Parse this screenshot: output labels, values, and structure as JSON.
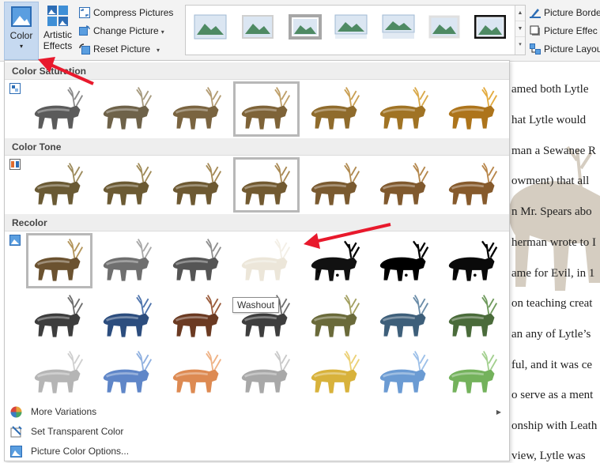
{
  "ribbon": {
    "color_label": "Color",
    "artistic_label_1": "Artistic",
    "artistic_label_2": "Effects",
    "compress_label": "Compress Pictures",
    "change_label": "Change Picture",
    "reset_label": "Reset Picture",
    "picture_border_label": "Picture Borde",
    "picture_effects_label": "Picture Effec",
    "picture_layout_label": "Picture Layou"
  },
  "color_panel": {
    "sections": [
      {
        "title": "Color Saturation",
        "icon": "color-saturation-icon",
        "selected_index": 3
      },
      {
        "title": "Color Tone",
        "icon": "color-tone-icon",
        "selected_index": 3
      },
      {
        "title": "Recolor",
        "icon": "recolor-icon",
        "selected_index": 0
      }
    ],
    "tooltip": "Washout",
    "menu": [
      {
        "label": "More Variations",
        "icon": "more-variations-icon",
        "has_submenu": true
      },
      {
        "label": "Set Transparent Color",
        "icon": "set-transparent-color-icon",
        "has_submenu": false
      },
      {
        "label": "Picture Color Options...",
        "icon": "picture-color-options-icon",
        "has_submenu": false
      }
    ]
  },
  "document": {
    "lines": [
      "amed both Lytle",
      "hat Lytle would",
      "man a Sewanee R",
      "owment) that all",
      "n Mr. Spears abo",
      "herman wrote to I",
      "ame for Evil, in 1",
      "on teaching creat",
      "an any of Lytle’s",
      "ful, and it was ce",
      "o serve as a ment",
      "onship with Leath",
      "view, Lytle was"
    ]
  },
  "colors": {
    "accent_selected": "#c6d9f0",
    "annotation_arrow": "#e8192c",
    "deer_original": "#6b5230"
  }
}
